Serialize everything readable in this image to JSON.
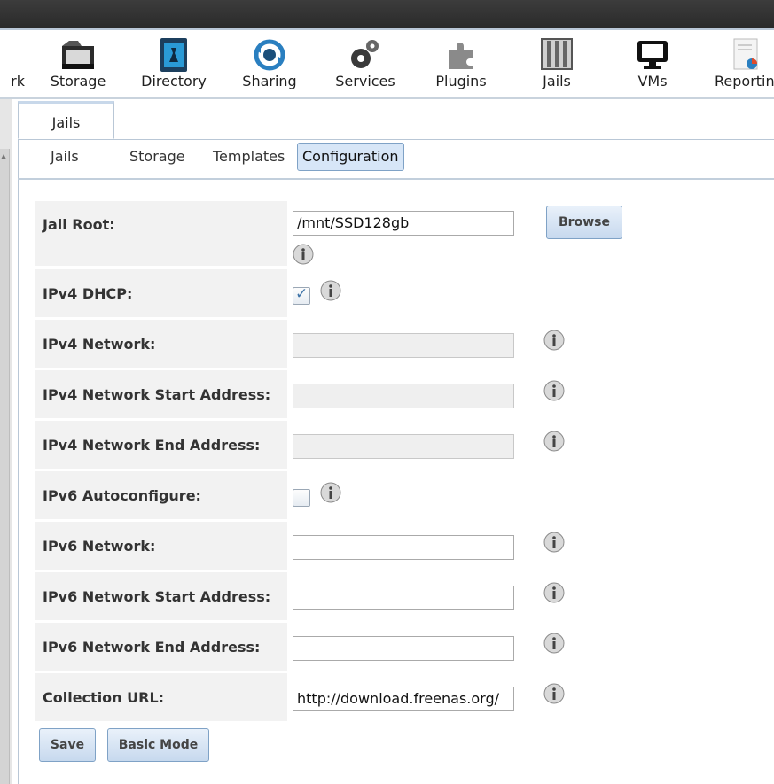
{
  "nav": {
    "items": [
      {
        "label": "rk",
        "icon": "network-icon"
      },
      {
        "label": "Storage",
        "icon": "storage-icon"
      },
      {
        "label": "Directory",
        "icon": "directory-icon"
      },
      {
        "label": "Sharing",
        "icon": "sharing-icon"
      },
      {
        "label": "Services",
        "icon": "services-icon"
      },
      {
        "label": "Plugins",
        "icon": "plugins-icon"
      },
      {
        "label": "Jails",
        "icon": "jails-icon"
      },
      {
        "label": "VMs",
        "icon": "vms-icon"
      },
      {
        "label": "Reportin",
        "icon": "reporting-icon"
      }
    ]
  },
  "tab": {
    "label": "Jails"
  },
  "subtabs": [
    {
      "label": "Jails"
    },
    {
      "label": "Storage"
    },
    {
      "label": "Templates"
    },
    {
      "label": "Configuration",
      "active": true
    }
  ],
  "form": {
    "jail_root": {
      "label": "Jail Root:",
      "value": "/mnt/SSD128gb",
      "browse_label": "Browse"
    },
    "ipv4_dhcp": {
      "label": "IPv4 DHCP:",
      "checked": true
    },
    "ipv4_network": {
      "label": "IPv4 Network:",
      "value": ""
    },
    "ipv4_start": {
      "label": "IPv4 Network Start Address:",
      "value": ""
    },
    "ipv4_end": {
      "label": "IPv4 Network End Address:",
      "value": ""
    },
    "ipv6_autoconf": {
      "label": "IPv6 Autoconfigure:",
      "checked": false
    },
    "ipv6_network": {
      "label": "IPv6 Network:",
      "value": ""
    },
    "ipv6_start": {
      "label": "IPv6 Network Start Address:",
      "value": ""
    },
    "ipv6_end": {
      "label": "IPv6 Network End Address:",
      "value": ""
    },
    "collection_url": {
      "label": "Collection URL:",
      "value": "http://download.freenas.org/"
    }
  },
  "buttons": {
    "save": "Save",
    "basic_mode": "Basic Mode"
  }
}
